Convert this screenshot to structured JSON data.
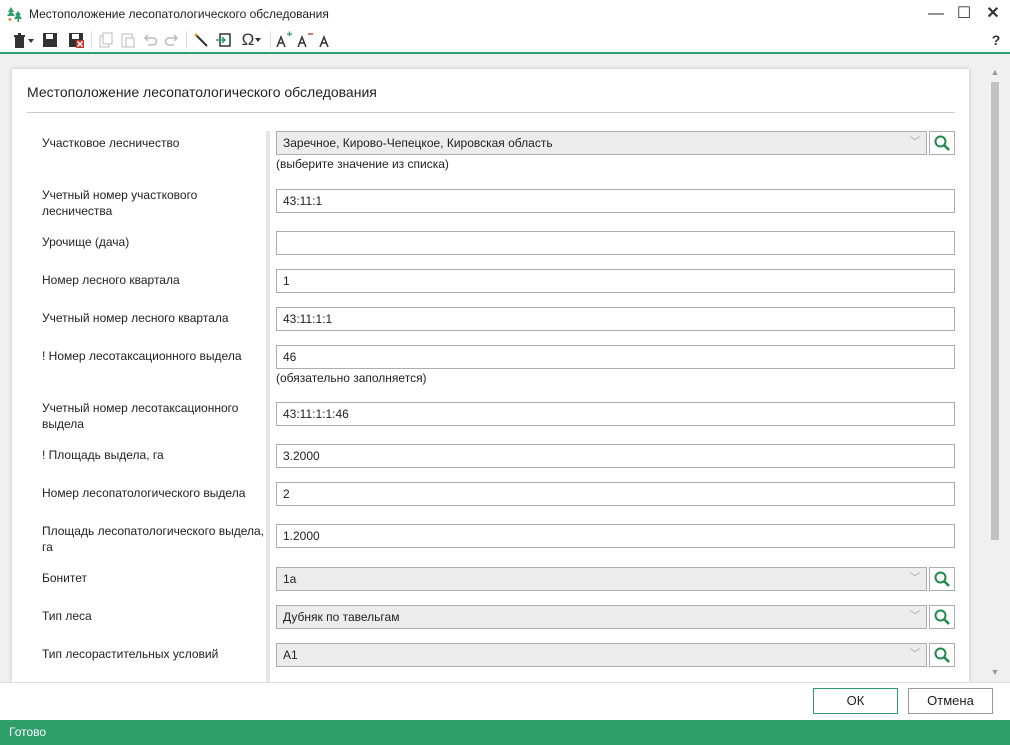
{
  "window": {
    "title": "Местоположение лесопатологического обследования",
    "minimize_glyph": "—",
    "maximize_glyph": "☐",
    "close_glyph": "✕"
  },
  "toolbar": {
    "omega_glyph": "Ω",
    "help_glyph": "?"
  },
  "form": {
    "title": "Местоположение лесопатологического обследования",
    "fields": [
      {
        "label": "Участковое лесничество",
        "value": "Заречное, Кирово-Чепецкое, Кировская область",
        "hint": "(выберите значение из списка)"
      },
      {
        "label": "Учетный номер участкового лесничества",
        "value": "43:11:1"
      },
      {
        "label": "Урочище (дача)",
        "value": ""
      },
      {
        "label": "Номер лесного квартала",
        "value": "1"
      },
      {
        "label": "Учетный номер лесного квартала",
        "value": "43:11:1:1"
      },
      {
        "label": "! Номер лесотаксационного выдела",
        "value": "46",
        "hint": "(обязательно заполняется)"
      },
      {
        "label": "Учетный номер лесотаксационного выдела",
        "value": "43:11:1:1:46"
      },
      {
        "label": "! Площадь выдела, га",
        "value": "3.2000"
      },
      {
        "label": "Номер лесопатологического выдела",
        "value": "2"
      },
      {
        "label": "Площадь лесопатологического выдела, га",
        "value": "1.2000"
      },
      {
        "label": "Бонитет",
        "value": "1а"
      },
      {
        "label": "Тип леса",
        "value": "Дубняк по тавельгам"
      },
      {
        "label": "Тип лесорастительных условий",
        "value": "А1"
      }
    ]
  },
  "buttons": {
    "ok": "ОК",
    "cancel": "Отмена"
  },
  "status": {
    "text": "Готово"
  },
  "colors": {
    "accent": "#2e9e6b",
    "search_icon": "#1f8a4c"
  }
}
